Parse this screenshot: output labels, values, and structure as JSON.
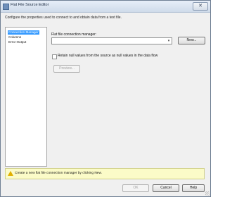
{
  "window": {
    "title": "Flat File Source Editor",
    "close_glyph": "✕"
  },
  "description": "Configure the properties used to connect to and obtain data from a text file.",
  "nav": {
    "items": [
      {
        "label": "Connection Manager",
        "selected": true
      },
      {
        "label": "Columns",
        "selected": false
      },
      {
        "label": "Error Output",
        "selected": false
      }
    ]
  },
  "connection": {
    "label": "Flat file connection manager:",
    "value": "",
    "new_button": "New..."
  },
  "retain_nulls": {
    "label": "Retain null values from the source as null values in the data flow",
    "checked": false
  },
  "preview_button": "Preview...",
  "info": {
    "message": "Create a new flat file connection manager by clicking New.",
    "icon": "warning-icon"
  },
  "buttons": {
    "ok": "OK",
    "cancel": "Cancel",
    "help": "Help"
  },
  "colors": {
    "selection": "#3399ff",
    "info_background": "#fbfbc8"
  }
}
